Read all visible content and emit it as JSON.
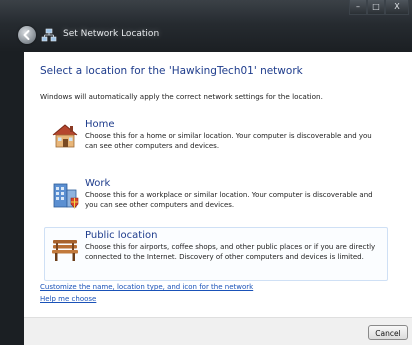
{
  "window": {
    "title": "Set Network Location",
    "caption_buttons": {
      "minimize": "–",
      "maximize": "□",
      "close": "X"
    }
  },
  "main": {
    "heading": "Select a location for the 'HawkingTech01' network",
    "subtext": "Windows will automatically apply the correct network settings for the location.",
    "options": [
      {
        "title": "Home",
        "icon": "home-icon",
        "description": "Choose this for a home or similar location. Your computer is discoverable and you can see other computers and devices."
      },
      {
        "title": "Work",
        "icon": "work-icon",
        "description": "Choose this for a workplace or similar location. Your computer is discoverable and you can see other computers and devices."
      },
      {
        "title": "Public location",
        "icon": "bench-icon",
        "description": "Choose this for airports, coffee shops, and other public places or if you are directly connected to the Internet. Discovery of other computers and devices is limited."
      }
    ],
    "links": {
      "customize": "Customize the name, location type, and icon for the network",
      "help": "Help me choose"
    }
  },
  "footer": {
    "cancel_label": "Cancel"
  },
  "colors": {
    "accent_blue": "#1e3c8c",
    "link_blue": "#1a52b8",
    "frame_dark": "#1b1f23"
  }
}
